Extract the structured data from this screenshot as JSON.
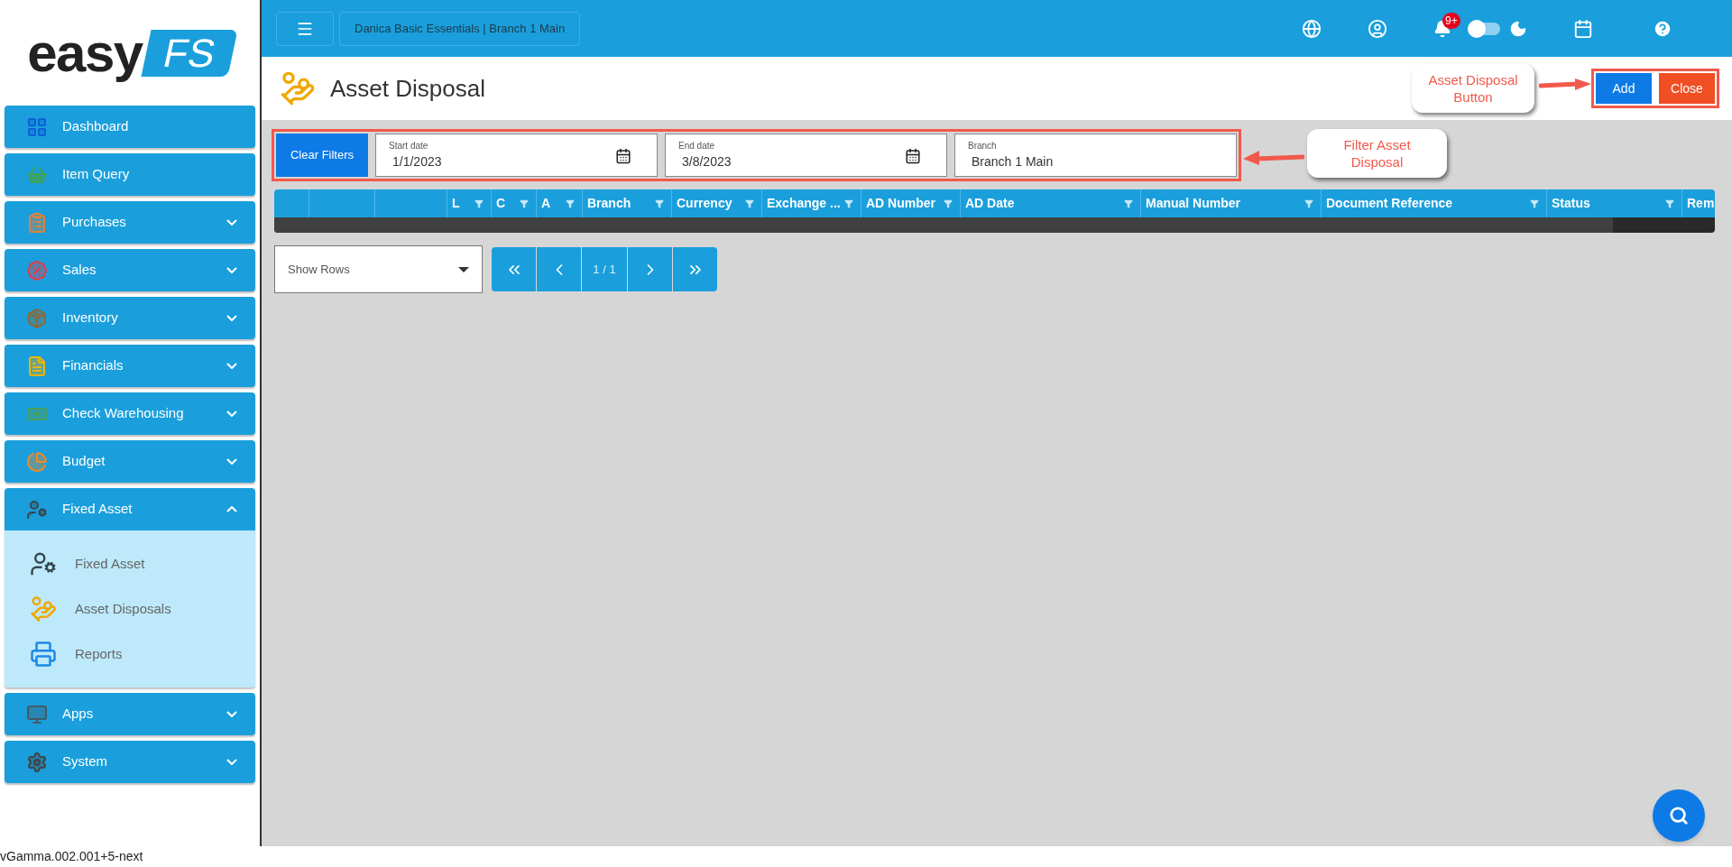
{
  "logo": {
    "word": "easy",
    "badge": "FS"
  },
  "topbar": {
    "company": "Danica Basic Essentials | Branch 1 Main",
    "notification_count": "9+",
    "dark_mode": {
      "on": false
    }
  },
  "sidebar": {
    "items": [
      {
        "label": "Dashboard",
        "kind": "link"
      },
      {
        "label": "Item Query",
        "kind": "link"
      },
      {
        "label": "Purchases",
        "kind": "group",
        "expanded": false
      },
      {
        "label": "Sales",
        "kind": "group",
        "expanded": false
      },
      {
        "label": "Inventory",
        "kind": "group",
        "expanded": false
      },
      {
        "label": "Financials",
        "kind": "group",
        "expanded": false
      },
      {
        "label": "Check Warehousing",
        "kind": "group",
        "expanded": false
      },
      {
        "label": "Budget",
        "kind": "group",
        "expanded": false
      },
      {
        "label": "Fixed Asset",
        "kind": "group",
        "expanded": true,
        "children": [
          {
            "label": "Fixed Asset"
          },
          {
            "label": "Asset Disposals"
          },
          {
            "label": "Reports"
          }
        ]
      },
      {
        "label": "Apps",
        "kind": "group",
        "expanded": false
      },
      {
        "label": "System",
        "kind": "group",
        "expanded": false
      }
    ]
  },
  "page": {
    "title": "Asset Disposal",
    "buttons": [
      {
        "label": "Add",
        "kind": "primary"
      },
      {
        "label": "Close",
        "kind": "danger"
      }
    ]
  },
  "filters": {
    "clear_button": "Clear Filters",
    "fields": [
      {
        "label": "Start date",
        "value": "1/1/2023",
        "kind": "date"
      },
      {
        "label": "End date",
        "value": "3/8/2023",
        "kind": "date"
      },
      {
        "label": "Branch",
        "value": "Branch 1 Main",
        "kind": "select"
      }
    ]
  },
  "table": {
    "columns": [
      {
        "filter": false
      },
      {
        "filter": false
      },
      {
        "filter": false
      },
      {
        "label": "L",
        "filter": true
      },
      {
        "label": "C",
        "filter": true
      },
      {
        "label": "A",
        "filter": true
      },
      {
        "label": "Branch",
        "filter": true
      },
      {
        "label": "Currency",
        "filter": true
      },
      {
        "label": "Exchange ...",
        "filter": true
      },
      {
        "label": "AD Number",
        "filter": true
      },
      {
        "label": "AD Date",
        "filter": true
      },
      {
        "label": "Manual Number",
        "filter": true
      },
      {
        "label": "Document Reference",
        "filter": true
      },
      {
        "label": "Status",
        "filter": true
      },
      {
        "label": "Rem"
      }
    ]
  },
  "pagination": {
    "show_rows": {
      "placeholder": "Show Rows"
    },
    "page": "1 / 1"
  },
  "annotations": [
    {
      "text": "Asset Disposal Button"
    },
    {
      "text": "Filter Asset Disposal"
    }
  ],
  "version": "vGamma.002.001+5-next"
}
